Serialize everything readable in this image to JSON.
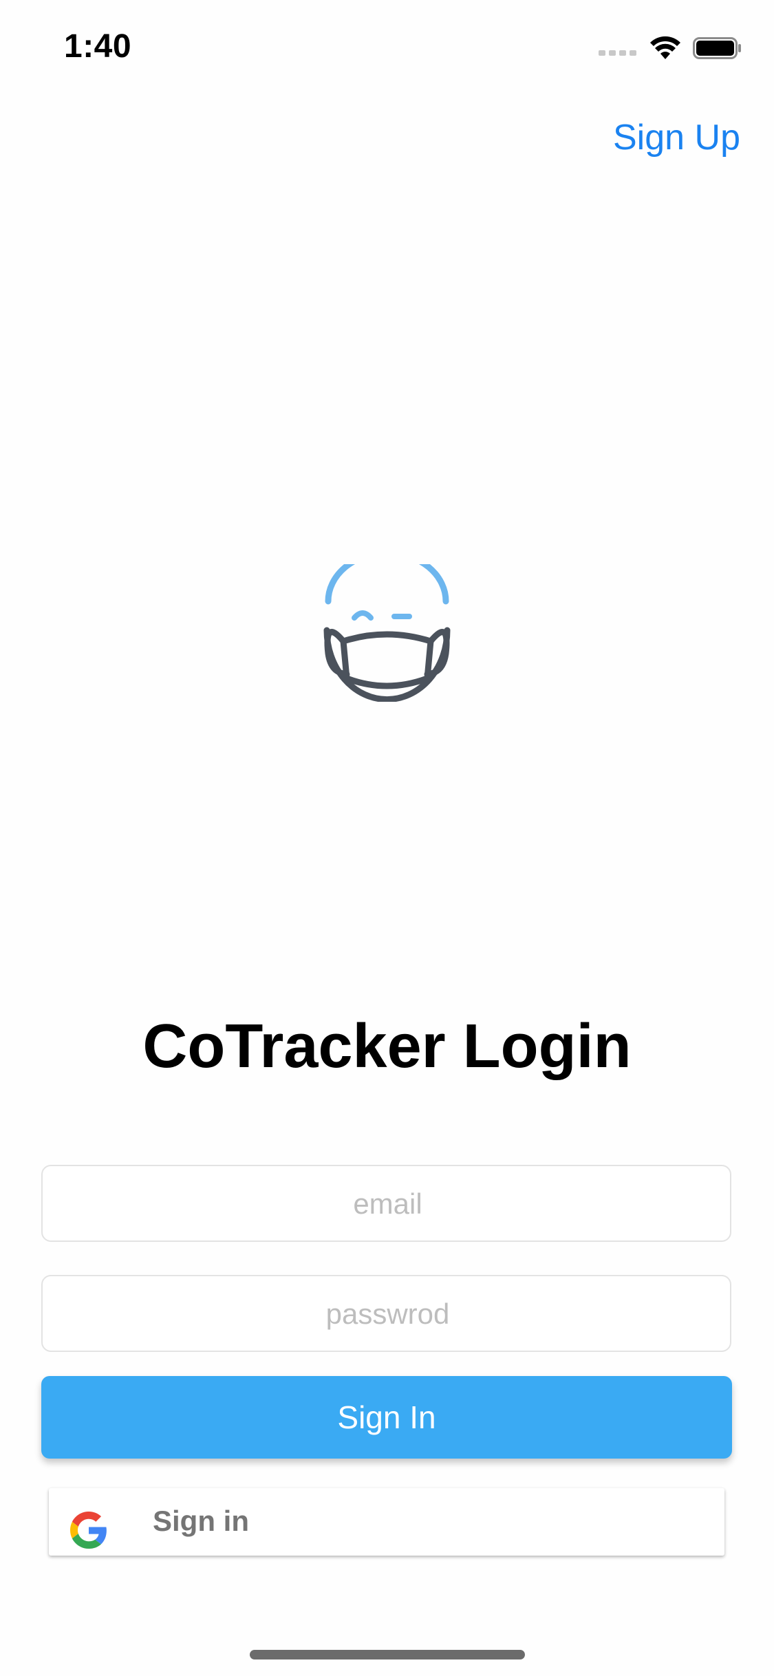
{
  "status_bar": {
    "time": "1:40"
  },
  "nav": {
    "sign_up_label": "Sign Up"
  },
  "logo": {
    "icon": "masked-face-icon",
    "colors": {
      "top": "#6db6ee",
      "outline": "#4b525c"
    }
  },
  "login": {
    "title": "CoTracker Login",
    "email_placeholder": "email",
    "email_value": "",
    "password_placeholder": "passwrod",
    "password_value": "",
    "sign_in_label": "Sign In",
    "google_sign_in_label": "Sign in"
  },
  "colors": {
    "accent": "#3aaaf3",
    "link": "#1a82f0",
    "placeholder": "#bdbdbd"
  }
}
